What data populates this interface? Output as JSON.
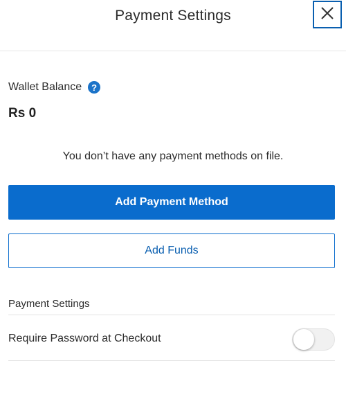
{
  "header": {
    "title": "Payment Settings",
    "close_icon": "close-icon"
  },
  "wallet": {
    "label": "Wallet Balance",
    "help_icon": "?",
    "amount": "Rs 0"
  },
  "payment_methods": {
    "empty_message": "You don’t have any payment methods on file.",
    "add_method_label": "Add Payment Method",
    "add_funds_label": "Add Funds"
  },
  "settings": {
    "section_title": "Payment Settings",
    "require_password_label": "Require Password at Checkout",
    "require_password_enabled": false
  },
  "colors": {
    "primary": "#0a6ccd",
    "close_border": "#0a5fb0",
    "help_icon": "#1b73c9"
  }
}
